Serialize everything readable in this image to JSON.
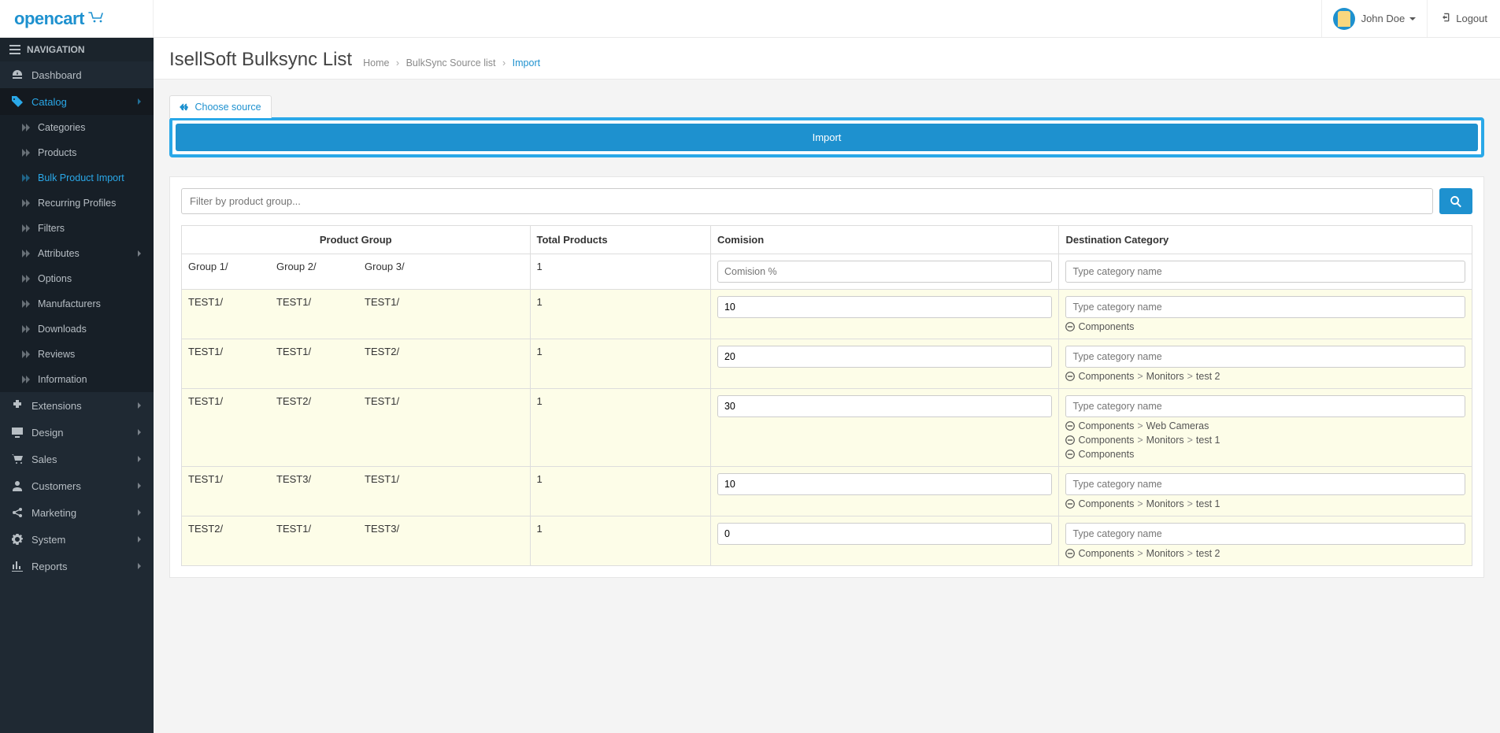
{
  "brand": "opencart",
  "user_name": "John Doe",
  "logout_label": "Logout",
  "nav_header": "NAVIGATION",
  "sidebar": {
    "dashboard": "Dashboard",
    "catalog": "Catalog",
    "catalog_sub": {
      "categories": "Categories",
      "products": "Products",
      "bulk_import": "Bulk Product Import",
      "recurring": "Recurring Profiles",
      "filters": "Filters",
      "attributes": "Attributes",
      "options": "Options",
      "manufacturers": "Manufacturers",
      "downloads": "Downloads",
      "reviews": "Reviews",
      "information": "Information"
    },
    "extensions": "Extensions",
    "design": "Design",
    "sales": "Sales",
    "customers": "Customers",
    "marketing": "Marketing",
    "system": "System",
    "reports": "Reports"
  },
  "page_title": "IsellSoft Bulksync List",
  "breadcrumb": {
    "home": "Home",
    "list": "BulkSync Source list",
    "current": "Import"
  },
  "choose_source": "Choose source",
  "import_label": "Import",
  "filter_placeholder": "Filter by product group...",
  "columns": {
    "pg": "Product Group",
    "total": "Total Products",
    "comision": "Comision",
    "dest": "Destination Category"
  },
  "header_row": {
    "groups": [
      "Group 1/",
      "Group 2/",
      "Group 3/"
    ],
    "total": "1",
    "comision_value": "",
    "comision_placeholder": "Comision %",
    "cat_placeholder": "Type category name"
  },
  "cat_placeholder": "Type category name",
  "rows": [
    {
      "groups": [
        "TEST1/",
        "TEST1/",
        "TEST1/"
      ],
      "total": "1",
      "comision": "10",
      "cats": [
        [
          "Components"
        ]
      ]
    },
    {
      "groups": [
        "TEST1/",
        "TEST1/",
        "TEST2/"
      ],
      "total": "1",
      "comision": "20",
      "cats": [
        [
          "Components",
          "Monitors",
          "test 2"
        ]
      ]
    },
    {
      "groups": [
        "TEST1/",
        "TEST2/",
        "TEST1/"
      ],
      "total": "1",
      "comision": "30",
      "cats": [
        [
          "Components",
          "Web Cameras"
        ],
        [
          "Components",
          "Monitors",
          "test 1"
        ],
        [
          "Components"
        ]
      ]
    },
    {
      "groups": [
        "TEST1/",
        "TEST3/",
        "TEST1/"
      ],
      "total": "1",
      "comision": "10",
      "cats": [
        [
          "Components",
          "Monitors",
          "test 1"
        ]
      ]
    },
    {
      "groups": [
        "TEST2/",
        "TEST1/",
        "TEST3/"
      ],
      "total": "1",
      "comision": "0",
      "cats": [
        [
          "Components",
          "Monitors",
          "test 2"
        ]
      ]
    }
  ]
}
